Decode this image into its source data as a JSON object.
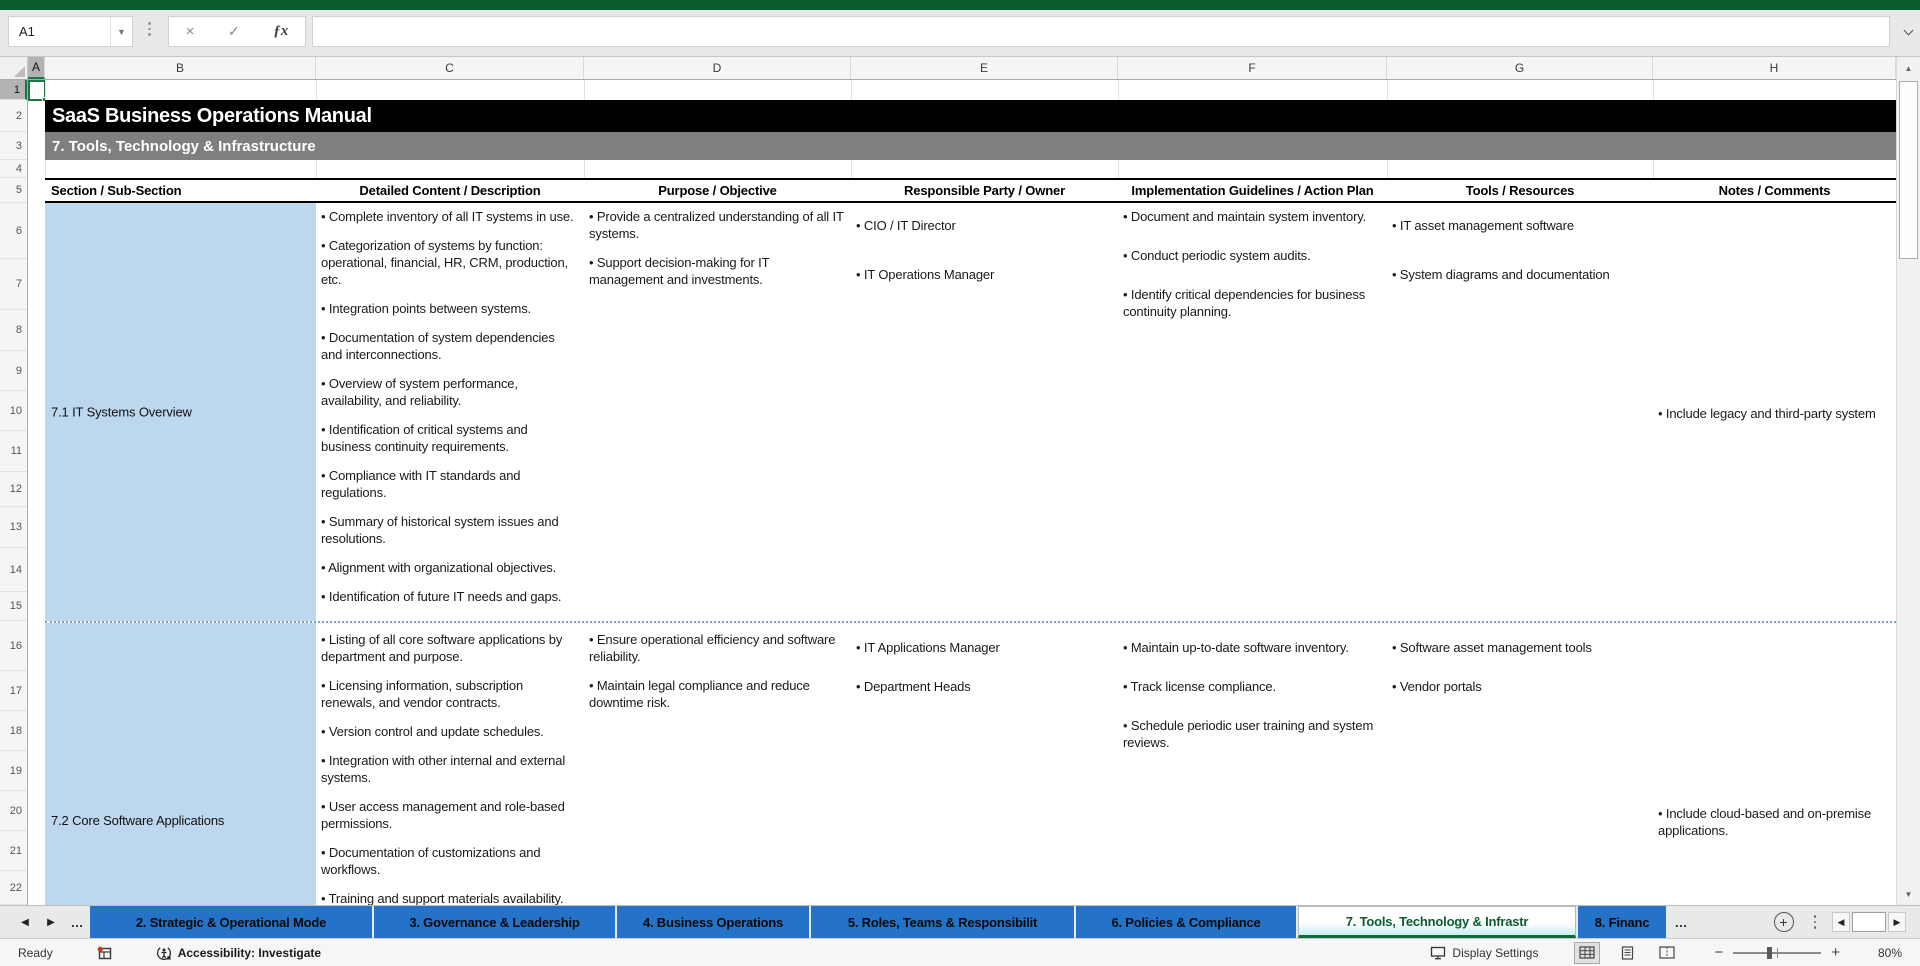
{
  "colors": {
    "accent_green": "#0E5C2E",
    "tab_blue": "#2473C8",
    "active_tab_text": "#0B5C2D",
    "section_fill": "#BDD7EE",
    "title_bg": "#000000",
    "subtitle_bg": "#7F7F7F"
  },
  "formula_bar": {
    "name_box": "A1",
    "formula_value": "",
    "cancel_glyph": "×",
    "enter_glyph": "✓",
    "fx_glyph": "ƒx"
  },
  "columns": [
    "A",
    "B",
    "C",
    "D",
    "E",
    "F",
    "G",
    "H"
  ],
  "rows": [
    "1",
    "2",
    "3",
    "4",
    "5",
    "6",
    "7",
    "8",
    "9",
    "10",
    "11",
    "12",
    "13",
    "14",
    "15",
    "16",
    "17",
    "18",
    "19",
    "20",
    "21",
    "22"
  ],
  "sheet": {
    "title": "SaaS Business Operations Manual",
    "subtitle": "7. Tools, Technology & Infrastructure"
  },
  "table": {
    "headers": [
      "Section / Sub-Section",
      "Detailed Content / Description",
      "Purpose / Objective",
      "Responsible Party / Owner",
      "Implementation Guidelines / Action Plan",
      "Tools / Resources",
      "Notes / Comments"
    ],
    "sections": [
      {
        "label": "7.1 IT Systems Overview",
        "content": [
          "Complete inventory of all IT systems in use.",
          "Categorization of systems by function: operational, financial, HR, CRM, production, etc.",
          "Integration points between systems.",
          "Documentation of system dependencies and interconnections.",
          "Overview of system performance, availability, and reliability.",
          "Identification of critical systems and business continuity requirements.",
          "Compliance with IT standards and regulations.",
          "Summary of historical system issues and resolutions.",
          "Alignment with organizational objectives.",
          "Identification of future IT needs and gaps."
        ],
        "purpose": [
          "Provide a centralized understanding of all IT systems.",
          "Support decision-making for IT management and investments."
        ],
        "responsible": [
          "CIO / IT Director",
          "IT Operations Manager"
        ],
        "implementation": [
          "Document and maintain system inventory.",
          "Conduct periodic system audits.",
          "Identify critical dependencies for business continuity planning."
        ],
        "tools": [
          "IT asset management software",
          "System diagrams and documentation"
        ],
        "notes": [
          "Include legacy and third-party system"
        ]
      },
      {
        "label": "7.2 Core Software Applications",
        "content": [
          "Listing of all core software applications by department and purpose.",
          "Licensing information, subscription renewals, and vendor contracts.",
          "Version control and update schedules.",
          "Integration with other internal and external systems.",
          "User access management and role-based permissions.",
          "Documentation of customizations and workflows.",
          "Training and support materials availability."
        ],
        "purpose": [
          "Ensure operational efficiency and software reliability.",
          "Maintain legal compliance and reduce downtime risk."
        ],
        "responsible": [
          "IT Applications Manager",
          "Department Heads"
        ],
        "implementation": [
          "Maintain up-to-date software inventory.",
          "Track license compliance.",
          "Schedule periodic user training and system reviews."
        ],
        "tools": [
          "Software asset management tools",
          "Vendor portals"
        ],
        "notes": [
          "Include cloud-based and on-premise applications."
        ]
      }
    ]
  },
  "tabs": {
    "nav_left": "◀",
    "nav_right": "▶",
    "ellipsis_left": "…",
    "ellipsis_right": "…",
    "add_glyph": "+",
    "items": [
      {
        "label": "2. Strategic & Operational Mode",
        "active": false
      },
      {
        "label": "3. Governance & Leadership",
        "active": false
      },
      {
        "label": "4. Business Operations",
        "active": false
      },
      {
        "label": "5. Roles, Teams & Responsibilit",
        "active": false
      },
      {
        "label": "6. Policies & Compliance",
        "active": false
      },
      {
        "label": "7. Tools, Technology & Infrastr",
        "active": true
      },
      {
        "label": "8. Financ",
        "active": false
      }
    ]
  },
  "status_bar": {
    "ready": "Ready",
    "accessibility": "Accessibility: Investigate",
    "display_settings": "Display Settings",
    "zoom_out": "−",
    "zoom_in": "+",
    "zoom_level": "80%"
  },
  "scrollbar": {
    "up_glyph": "▲",
    "down_glyph": "▼",
    "left_glyph": "◀",
    "right_glyph": "▶",
    "name_dd_glyph": "▼"
  }
}
